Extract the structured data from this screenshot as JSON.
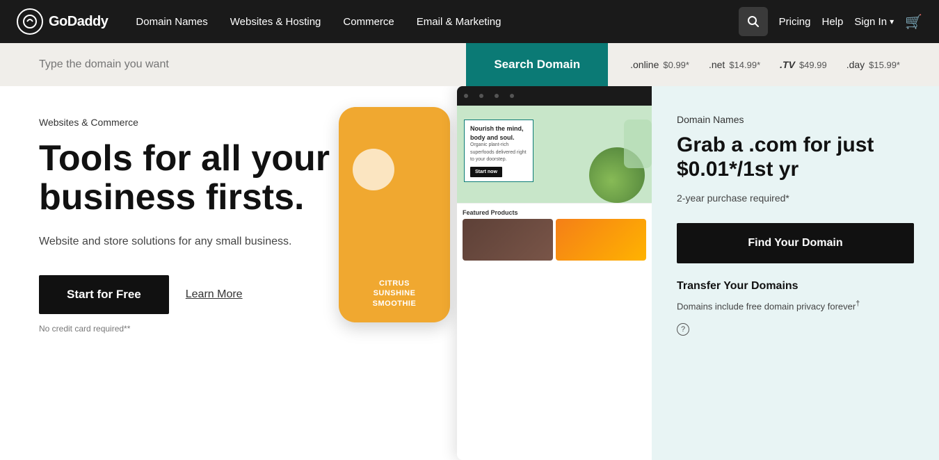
{
  "nav": {
    "logo_text": "GoDaddy",
    "links": [
      {
        "id": "domain-names",
        "label": "Domain Names"
      },
      {
        "id": "websites-hosting",
        "label": "Websites & Hosting"
      },
      {
        "id": "commerce",
        "label": "Commerce"
      },
      {
        "id": "email-marketing",
        "label": "Email & Marketing"
      }
    ],
    "pricing_label": "Pricing",
    "help_label": "Help",
    "signin_label": "Sign In"
  },
  "search_bar": {
    "placeholder": "Type the domain you want",
    "button_label": "Search Domain",
    "tlds": [
      {
        "name": ".online",
        "price": "$0.99*"
      },
      {
        "name": ".net",
        "price": "$14.99*"
      },
      {
        "name": ".TV",
        "price": "$49.99"
      },
      {
        "name": ".day",
        "price": "$15.99*"
      }
    ]
  },
  "hero_left": {
    "category": "Websites & Commerce",
    "title": "Tools for all your business firsts.",
    "subtitle": "Website and store solutions for any small business.",
    "start_label": "Start for Free",
    "learn_label": "Learn More",
    "no_credit": "No credit card required**",
    "phone": {
      "label1": "CITRUS",
      "label2": "SUNSHINE",
      "label3": "SMOOTHIE"
    },
    "site_hero_text": "Nourish the mind, body and soul.",
    "site_hero_sub": "Organic plant-rich superfoods delivered right to your doorstep.",
    "site_cta": "Start now",
    "featured_label": "Featured Products"
  },
  "hero_right": {
    "category": "Domain Names",
    "title": "Grab a .com for just $0.01*/1st yr",
    "subtitle": "2-year purchase required*",
    "find_label": "Find Your Domain",
    "transfer_title": "Transfer Your Domains",
    "transfer_desc": "Domains include free domain privacy forever",
    "transfer_super": "†",
    "help_label": "?"
  }
}
